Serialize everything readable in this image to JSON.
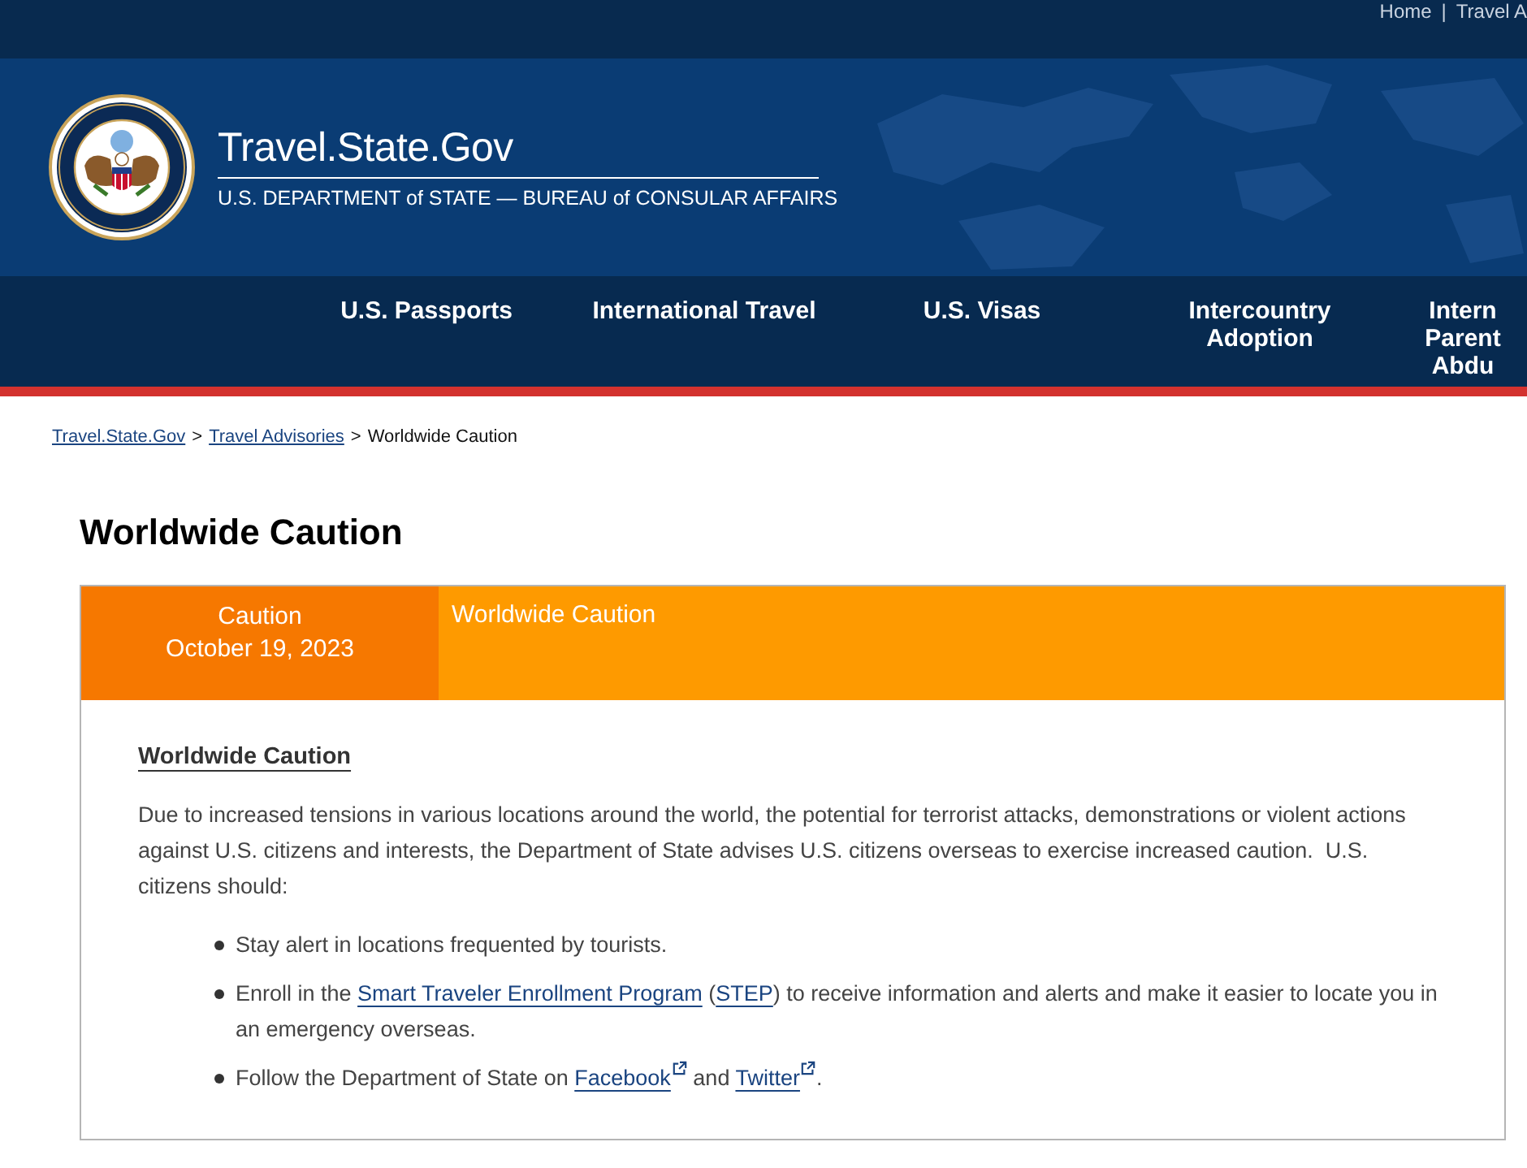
{
  "utility_nav": {
    "links": [
      "Home",
      "Travel A"
    ],
    "separator": "|"
  },
  "header": {
    "title": "Travel.State.Gov",
    "subtitle": "U.S. DEPARTMENT of STATE — BUREAU of CONSULAR AFFAIRS"
  },
  "main_nav": [
    "U.S. Passports",
    "International Travel",
    "U.S. Visas",
    "Intercountry Adoption",
    "Intern Parent Abdu"
  ],
  "breadcrumb": {
    "separator": ">",
    "items": [
      {
        "kind": "link",
        "label": "Travel.State.Gov"
      },
      {
        "kind": "link",
        "label": "Travel Advisories"
      },
      {
        "kind": "current",
        "label": "Worldwide Caution"
      }
    ]
  },
  "page_title": "Worldwide Caution",
  "advisory": {
    "badge_label": "Caution",
    "date": "October 19, 2023",
    "title": "Worldwide Caution",
    "heading": "Worldwide Caution",
    "paragraph": "Due to increased tensions in various locations around the world, the potential for terrorist attacks, demonstrations or violent actions against U.S. citizens and interests, the Department of State advises U.S. citizens overseas to exercise increased caution.  U.S. citizens should:",
    "bullets": [
      {
        "parts": [
          {
            "kind": "text",
            "text": "Stay alert in locations frequented by tourists."
          }
        ]
      },
      {
        "parts": [
          {
            "kind": "text",
            "text": "Enroll in the "
          },
          {
            "kind": "link",
            "text": "Smart Traveler Enrollment Program",
            "external": false
          },
          {
            "kind": "text",
            "text": " ("
          },
          {
            "kind": "link",
            "text": "STEP",
            "external": false
          },
          {
            "kind": "text",
            "text": ") to receive information and alerts and make it easier to locate you in an emergency overseas."
          }
        ]
      },
      {
        "parts": [
          {
            "kind": "text",
            "text": "Follow the Department of State on "
          },
          {
            "kind": "link",
            "text": "Facebook",
            "external": true
          },
          {
            "kind": "text",
            "text": " and "
          },
          {
            "kind": "link",
            "text": "Twitter",
            "external": true
          },
          {
            "kind": "text",
            "text": "."
          }
        ]
      }
    ]
  }
}
